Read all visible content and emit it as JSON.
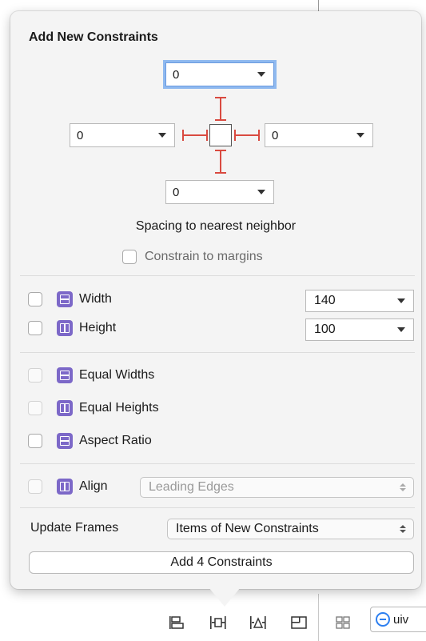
{
  "popover": {
    "title": "Add New Constraints",
    "spacing": {
      "top": "0",
      "left": "0",
      "right": "0",
      "bottom": "0",
      "label": "Spacing to nearest neighbor"
    },
    "constrain_margins_label": "Constrain to margins",
    "width": {
      "label": "Width",
      "value": "140"
    },
    "height": {
      "label": "Height",
      "value": "100"
    },
    "equal_widths_label": "Equal Widths",
    "equal_heights_label": "Equal Heights",
    "aspect_ratio_label": "Aspect Ratio",
    "align": {
      "label": "Align",
      "value": "Leading Edges"
    },
    "update_frames": {
      "label": "Update Frames",
      "value": "Items of New Constraints"
    },
    "add_button_label": "Add 4 Constraints"
  },
  "bottom_toolbar": {
    "icons": [
      "stack-icon",
      "pin-icon",
      "resolve-issues-icon",
      "resizing-icon",
      "grid-icon"
    ],
    "object_field_text": "uiv"
  },
  "colors": {
    "strut": "#d94a40",
    "constraint_icon": "#7c68c8",
    "focus_ring": "#8fb9ef",
    "accent_blue": "#2d7ff0"
  }
}
